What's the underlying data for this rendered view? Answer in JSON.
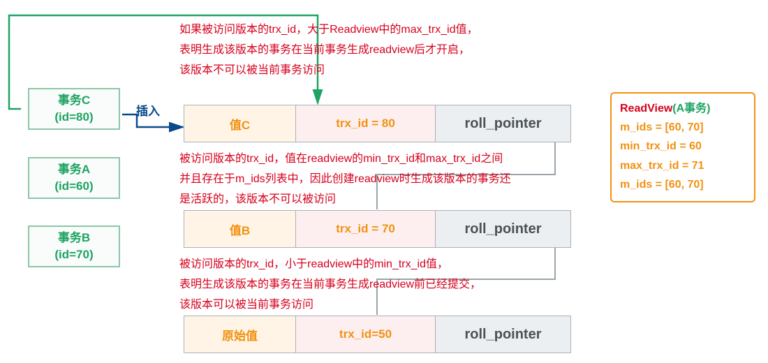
{
  "transactions": {
    "c": {
      "name": "事务C",
      "id": "(id=80)"
    },
    "a": {
      "name": "事务A",
      "id": "(id=60)"
    },
    "b": {
      "name": "事务B",
      "id": "(id=70)"
    }
  },
  "insertLabel": "插入",
  "rows": {
    "r1": {
      "value": "值C",
      "trx": "trx_id = 80",
      "roll": "roll_pointer"
    },
    "r2": {
      "value": "值B",
      "trx": "trx_id = 70",
      "roll": "roll_pointer"
    },
    "r3": {
      "value": "原始值",
      "trx": "trx_id=50",
      "roll": "roll_pointer"
    }
  },
  "notes": {
    "n1": "如果被访问版本的trx_id，大于Readview中的max_trx_id值，\n表明生成该版本的事务在当前事务生成readview后才开启，\n该版本不可以被当前事务访问",
    "n2": "被访问版本的trx_id，值在readview的min_trx_id和max_trx_id之间\n并且存在于m_ids列表中，因此创建readview时生成该版本的事务还\n是活跃的，该版本不可以被访问",
    "n3": "被访问版本的trx_id，小于readview中的min_trx_id值，\n表明生成该版本的事务在当前事务生成readview前已经提交，\n该版本可以被当前事务访问"
  },
  "readview": {
    "titleName": "ReadView",
    "titleParen": "(A事务)",
    "line1": "m_ids = [60, 70]",
    "line2": "min_trx_id = 60",
    "line3": "max_trx_id = 71",
    "line4": "m_ids = [60, 70]"
  }
}
